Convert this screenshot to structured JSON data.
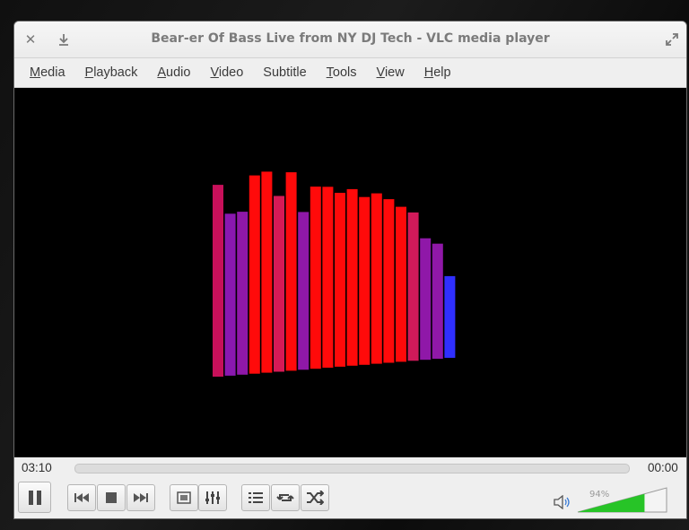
{
  "window": {
    "title": "Bear-er Of Bass Live from NY  DJ Tech - VLC media player"
  },
  "menu": [
    {
      "accel": "M",
      "rest": "edia"
    },
    {
      "accel": "P",
      "rest": "layback"
    },
    {
      "accel": "A",
      "rest": "udio"
    },
    {
      "accel": "V",
      "rest": "ideo"
    },
    {
      "accel": "S",
      "rest": "ubtitle"
    },
    {
      "accel": "T",
      "rest": "ools"
    },
    {
      "accel": "V",
      "rest": "iew"
    },
    {
      "accel": "H",
      "rest": "elp"
    }
  ],
  "playback": {
    "elapsed": "03:10",
    "remaining": "00:00",
    "progress": 0.0
  },
  "volume": {
    "label": "94%",
    "level": 0.94
  },
  "visualizer": {
    "bar_levels": [
      0.93,
      0.79,
      0.8,
      0.98,
      1.0,
      0.88,
      1.0,
      0.8,
      0.93,
      0.93,
      0.9,
      0.92,
      0.88,
      0.9,
      0.87,
      0.83,
      0.8,
      0.66,
      0.63,
      0.45
    ],
    "bar_colors": [
      "#c8105a",
      "#8a18b0",
      "#8f18a8",
      "#ff0a0a",
      "#ff0a0a",
      "#d61a56",
      "#ff0a0a",
      "#8f18a8",
      "#ff0a0a",
      "#ff0a0a",
      "#ff0a0a",
      "#ff0a0a",
      "#ff0a0a",
      "#ff0a0a",
      "#ff0a0a",
      "#ff0a0a",
      "#d01a5a",
      "#8f18a8",
      "#9018a8",
      "#2f2fff"
    ]
  },
  "colors": {
    "volume_fill": "#27c427",
    "titlebar_text": "#7b7b7b"
  }
}
